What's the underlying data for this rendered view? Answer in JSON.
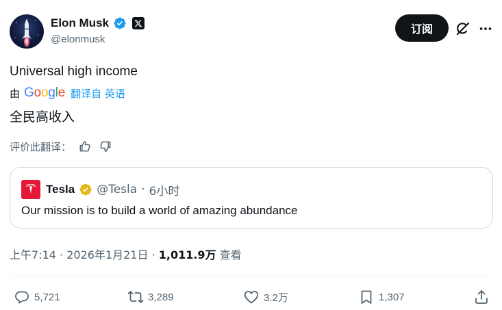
{
  "author": {
    "name": "Elon Musk",
    "handle": "@elonmusk",
    "verified": true,
    "affiliation": "x-logo-badge"
  },
  "header_actions": {
    "subscribe_label": "订阅",
    "grok_icon": "grok-icon",
    "more_icon": "more-icon"
  },
  "tweet": {
    "text": "Universal high income",
    "translation": {
      "by_label": "由",
      "provider": "Google",
      "source_label": "翻译自 英语",
      "translated_text": "全民高收入",
      "rate_label": "评价此翻译："
    }
  },
  "quote": {
    "name": "Tesla",
    "handle": "@Tesla",
    "separator": "·",
    "age": "6小时",
    "text": "Our mission is to build a world of amazing abundance",
    "verified_color": "#e2b719",
    "logo_color": "#e31937"
  },
  "meta": {
    "time": "上午7:14",
    "sep1": " · ",
    "date": "2026年1月21日",
    "sep2": " · ",
    "views": "1,011.9万",
    "views_label": " 查看"
  },
  "actions": {
    "reply_count": "5,721",
    "repost_count": "3,289",
    "like_count": "3.2万",
    "bookmark_count": "1,307"
  },
  "colors": {
    "accent": "#1d9bf0",
    "text": "#0f1419",
    "secondary": "#536471",
    "border": "#cfd9de"
  }
}
